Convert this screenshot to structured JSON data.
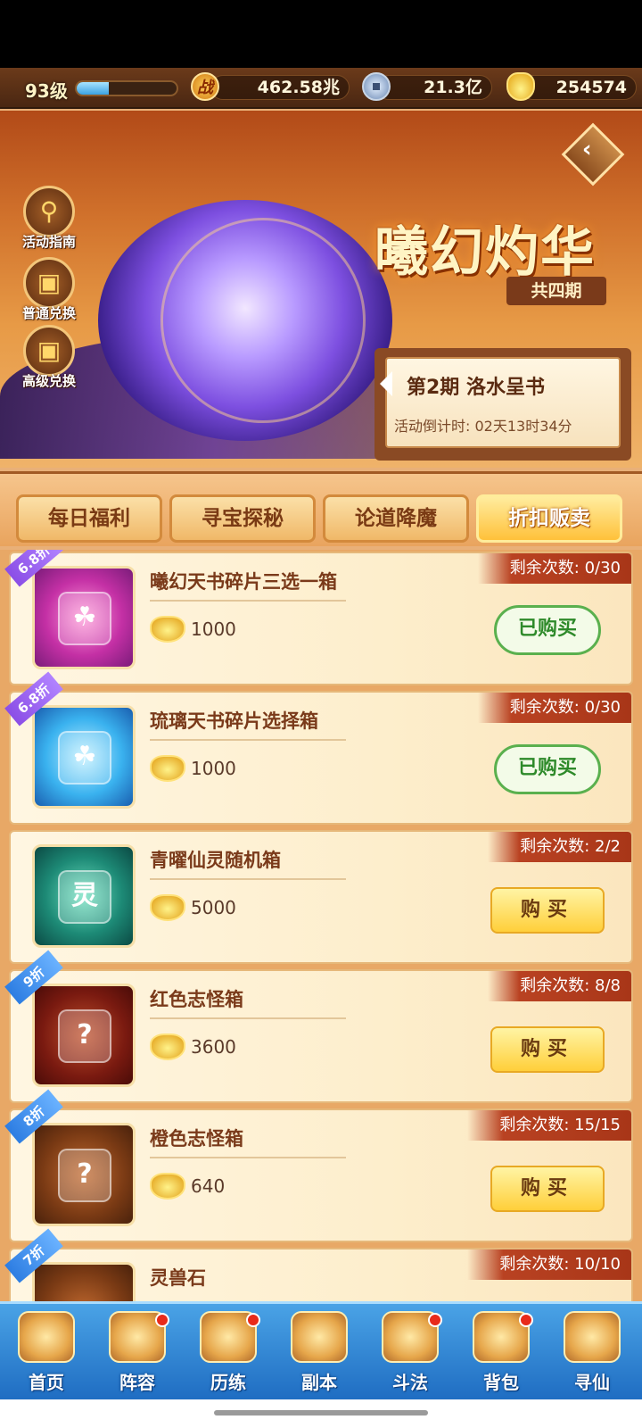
{
  "header": {
    "level": "93级",
    "xp_fraction": 0.32,
    "combat_power": "462.58兆",
    "coins": "21.3亿",
    "ingots": "254574",
    "zhan_glyph": "战"
  },
  "banner": {
    "title": "曦幻灼华",
    "periods_tag": "共四期",
    "period_title": "第2期  洛水呈书",
    "countdown": "活动倒计时: 02天13时34分"
  },
  "side_buttons": [
    {
      "label": "活动指南",
      "icon": "magnifier-icon"
    },
    {
      "label": "普通兑换",
      "icon": "gift-box-icon"
    },
    {
      "label": "高级兑换",
      "icon": "gift-box-icon"
    }
  ],
  "tabs": [
    {
      "label": "每日福利",
      "active": false
    },
    {
      "label": "寻宝探秘",
      "active": false
    },
    {
      "label": "论道降魔",
      "active": false
    },
    {
      "label": "折扣贩卖",
      "active": true
    }
  ],
  "items": [
    {
      "name": "曦幻天书碎片三选一箱",
      "price": "1000",
      "remaining": "剩余次数: 0/30",
      "discount": "6.8折",
      "status": "已购买"
    },
    {
      "name": "琉璃天书碎片选择箱",
      "price": "1000",
      "remaining": "剩余次数: 0/30",
      "discount": "6.8折",
      "status": "已购买"
    },
    {
      "name": "青曜仙灵随机箱",
      "price": "5000",
      "remaining": "剩余次数: 2/2",
      "discount": "",
      "status": "购买"
    },
    {
      "name": "红色志怪箱",
      "price": "3600",
      "remaining": "剩余次数: 8/8",
      "discount": "9折",
      "status": "购买"
    },
    {
      "name": "橙色志怪箱",
      "price": "640",
      "remaining": "剩余次数: 15/15",
      "discount": "8折",
      "status": "购买"
    },
    {
      "name": "灵兽石",
      "price": "",
      "remaining": "剩余次数: 10/10",
      "discount": "7折",
      "status": ""
    }
  ],
  "icon_glyphs": {
    "ling": "灵",
    "question": "?"
  },
  "nav": [
    {
      "label": "首页",
      "dot": false
    },
    {
      "label": "阵容",
      "dot": true
    },
    {
      "label": "历练",
      "dot": true
    },
    {
      "label": "副本",
      "dot": false
    },
    {
      "label": "斗法",
      "dot": true
    },
    {
      "label": "背包",
      "dot": true
    },
    {
      "label": "寻仙",
      "dot": false
    }
  ],
  "colors": {
    "accent": "#ffc13a",
    "bought_green": "#5ab04e",
    "remain_red": "#b94222",
    "nav_blue": "#1f6dc2"
  }
}
